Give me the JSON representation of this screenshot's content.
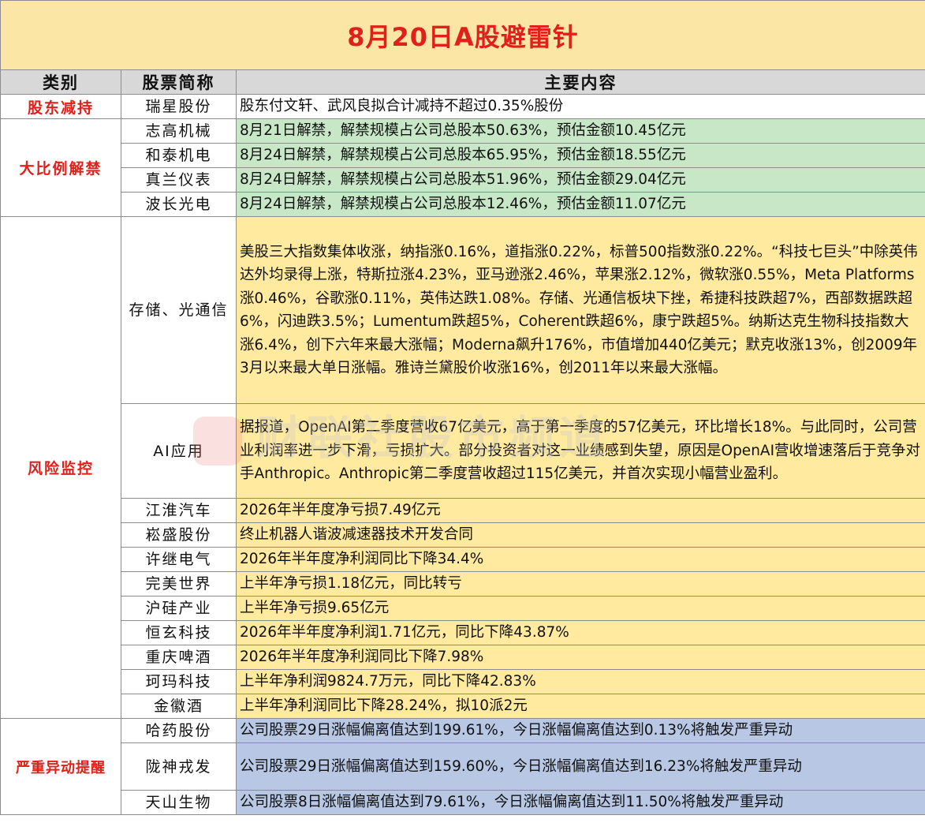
{
  "title": "8月20日A股避雷针",
  "headers": {
    "category": "类别",
    "stock": "股票简称",
    "content": "主要内容"
  },
  "groups": [
    {
      "category": "股东减持",
      "rows": [
        {
          "stock": "瑞星股份",
          "content": "股东付文轩、武风良拟合计减持不超过0.35%股份"
        }
      ]
    },
    {
      "category": "大比例解禁",
      "rows": [
        {
          "stock": "志高机械",
          "content": "8月21日解禁，解禁规模占公司总股本50.63%，预估金额10.45亿元"
        },
        {
          "stock": "和泰机电",
          "content": "8月24日解禁，解禁规模占公司总股本65.95%，预估金额18.55亿元"
        },
        {
          "stock": "真兰仪表",
          "content": "8月24日解禁，解禁规模占公司总股本51.96%，预估金额29.04亿元"
        },
        {
          "stock": "波长光电",
          "content": "8月24日解禁，解禁规模占公司总股本12.46%，预估金额11.07亿元"
        }
      ]
    },
    {
      "category": "风险监控",
      "rows": [
        {
          "stock": "存储、光通信",
          "content": "美股三大指数集体收涨，纳指涨0.16%，道指涨0.22%，标普500指数涨0.22%。“科技七巨头”中除英伟达外均录得上涨，特斯拉涨4.23%，亚马逊涨2.46%，苹果涨2.12%，微软涨0.55%，Meta Platforms涨0.46%，谷歌涨0.11%，英伟达跌1.08%。存储、光通信板块下挫，希捷科技跌超7%，西部数据跌超6%，闪迪跌3.5%；Lumentum跌超5%，Coherent跌超6%，康宁跌超5%。纳斯达克生物科技指数大涨6.4%，创下六年来最大涨幅；Moderna飙升176%，市值增加440亿美元；默克收涨13%，创2009年3月以来最大单日涨幅。雅诗兰黛股价收涨16%，创2011年以来最大涨幅。"
        },
        {
          "stock": "AI应用",
          "content": "据报道，OpenAI第二季度营收67亿美元，高于第一季度的57亿美元，环比增长18%。与此同时，公司营业利润率进一步下滑，亏损扩大。部分投资者对这一业绩感到失望，原因是OpenAI营收增速落后于竞争对手Anthropic。Anthropic第二季度营收超过115亿美元，并首次实现小幅营业盈利。"
        },
        {
          "stock": "江淮汽车",
          "content": "2026年半年度净亏损7.49亿元"
        },
        {
          "stock": "崧盛股份",
          "content": "终止机器人谐波减速器技术开发合同"
        },
        {
          "stock": "许继电气",
          "content": "2026年半年度净利润同比下降34.4%"
        },
        {
          "stock": "完美世界",
          "content": "上半年净亏损1.18亿元，同比转亏"
        },
        {
          "stock": "沪硅产业",
          "content": "上半年净亏损9.65亿元"
        },
        {
          "stock": "恒玄科技",
          "content": "2026年半年度净利润1.71亿元，同比下降43.87%"
        },
        {
          "stock": "重庆啤酒",
          "content": "2026年半年度净利润同比下降7.98%"
        },
        {
          "stock": "珂玛科技",
          "content": "上半年净利润9824.7万元，同比下降42.83%"
        },
        {
          "stock": "金徽酒",
          "content": "上半年净利润同比下降28.24%，拟10派2元"
        }
      ]
    },
    {
      "category": "严重异动提醒",
      "rows": [
        {
          "stock": "哈药股份",
          "content": "公司股票29日涨幅偏离值达到199.61%，今日涨幅偏离值达到0.13%将触发严重异动"
        },
        {
          "stock": "陇神戎发",
          "content": "公司股票29日涨幅偏离值达到159.60%，今日涨幅偏离值达到16.23%将触发严重异动"
        },
        {
          "stock": "天山生物",
          "content": "公司股票8日涨幅偏离值达到79.61%，今日涨幅偏离值达到11.50%将触发严重异动"
        }
      ]
    }
  ],
  "watermark": "财联社股市频道",
  "colors": {
    "title_bg": "#fbe6a6",
    "title_text": "#e0201a",
    "header_bg": "#d8d8d8",
    "unlock_bg": "#c7e7c6",
    "risk_bg": "#ffea9f",
    "alert_bg": "#b7c7e4"
  }
}
